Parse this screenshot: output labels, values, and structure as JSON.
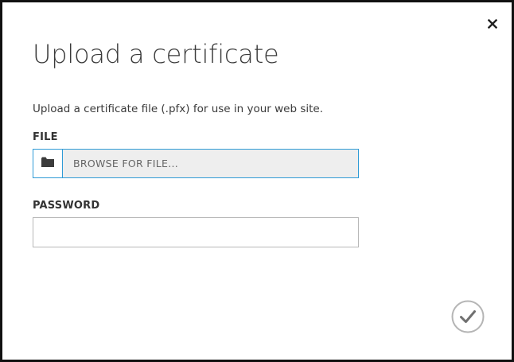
{
  "dialog": {
    "title": "Upload a certificate",
    "description": "Upload a certificate file (.pfx) for use in your web site.",
    "close_icon": "close-icon",
    "confirm_icon": "checkmark-icon"
  },
  "file_field": {
    "label": "FILE",
    "browse_text": "BROWSE FOR FILE...",
    "icon": "folder-icon"
  },
  "password_field": {
    "label": "PASSWORD",
    "value": ""
  },
  "colors": {
    "focus_border": "#2f9bd6",
    "browse_background": "#eeeeee",
    "text": "#333333",
    "confirm_ring": "#b5b5b5",
    "confirm_check": "#707070"
  }
}
